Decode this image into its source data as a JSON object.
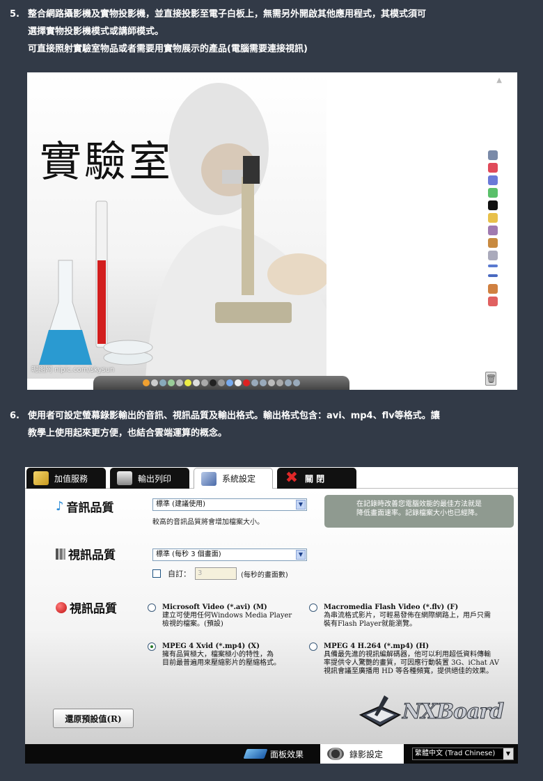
{
  "items": [
    {
      "number": "5.",
      "lines": [
        "整合網路攝影機及實物投影機，並直接投影至電子白板上，無需另外開啟其他應用程式，其模式須可",
        "選擇實物投影機模式或講師模式。",
        "可直接照射實驗室物品或者需要用實物展示的產品(電腦需要連接視訊)"
      ]
    },
    {
      "number": "6.",
      "lines": [
        "使用者可設定螢幕錄影輸出的音訊、視訊品質及輸出格式。輸出格式包含：avi、mp4、flv等格式。讓",
        "教學上使用起來更方便，也結合雲端運算的概念。"
      ]
    }
  ],
  "screenshot1": {
    "image_title": "實驗室",
    "watermark": "昵图网 nipic.com/skysun"
  },
  "screenshot2": {
    "tabs": [
      "加值服務",
      "輸出列印",
      "系統設定",
      "關 閉"
    ],
    "active_tab": "系統設定",
    "audio": {
      "title": "音訊品質",
      "selected": "標準 (建議使用)",
      "hint": "較高的音訊品質將會增加檔案大小。"
    },
    "tip": [
      "在記錄時改善您電腦效能的最佳方法就是",
      "降低畫面速率。記錄檔案大小也已經降。"
    ],
    "video": {
      "title": "視訊品質",
      "selected": "標準 (每秒 3 個畫面)",
      "custom_label": "自訂：",
      "custom_value": "3",
      "custom_unit": "(每秒的畫面數)"
    },
    "format": {
      "title": "視訊品質",
      "options": [
        {
          "name": "Microsoft Video (*.avi) (M)",
          "desc": [
            "建立可使用任何Windows Media Player",
            "檢視的檔案。(預設)"
          ],
          "selected": false
        },
        {
          "name": "Macromedia Flash Video (*.flv) (F)",
          "desc": [
            "為串流格式影片，可輕易發佈在網際網路上，用戶只需",
            "裝有Flash Player就能瀏覽。"
          ],
          "selected": false
        },
        {
          "name": "MPEG 4 Xvid (*.mp4) (X)",
          "desc": [
            "擁有品質極大，檔案極小的特性，為",
            "目前最普遍用來壓縮影片的壓縮格式。"
          ],
          "selected": true
        },
        {
          "name": "MPEG 4 H.264 (*.mp4) (H)",
          "desc": [
            "具備最先進的視訊編解碼器，他可以利用超低資料傳輸",
            "率提供令人驚艷的畫質，可因應行動裝置 3G、iChat AV",
            "視訊會議至廣播用 HD 等各種頻寬，提供絕佳的效果。"
          ],
          "selected": false
        }
      ]
    },
    "restore_button": "還原預設值(R)",
    "logo_text": "NXBoard",
    "status_tabs": [
      "面板效果",
      "錄影設定"
    ],
    "language": "繁體中文 (Trad Chinese)"
  },
  "colors": {
    "page_bg": "#323a47",
    "tab_bg": "#111111",
    "tip_bg": "#8f9a90",
    "close_icon": "#d42020"
  }
}
